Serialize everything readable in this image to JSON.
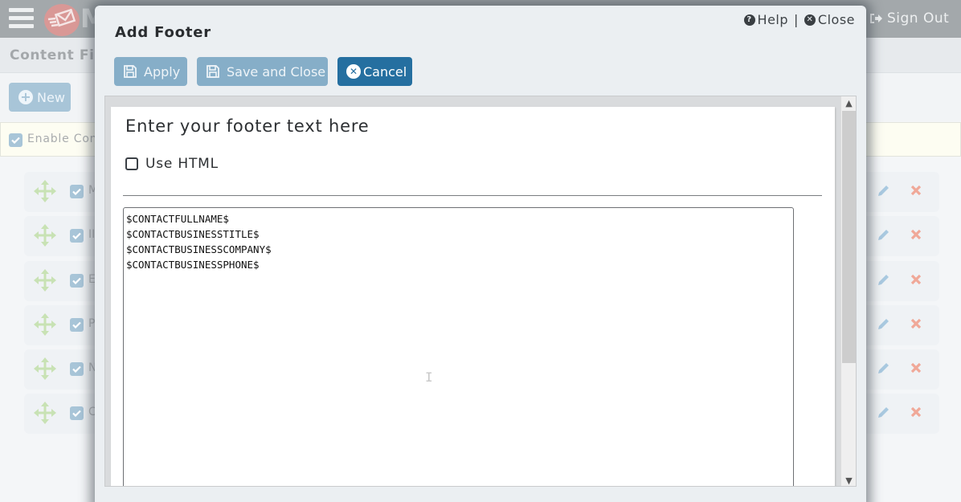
{
  "app": {
    "logo_letter": "M",
    "sign_out_label": "Sign Out",
    "page_title": "Content Fil",
    "new_button_label": "New",
    "enable_label": "Enable Con",
    "enable_checked": true,
    "list_items": [
      {
        "label": "M",
        "checked": true
      },
      {
        "label": "II",
        "checked": true
      },
      {
        "label": "E",
        "checked": true
      },
      {
        "label": "P",
        "checked": true
      },
      {
        "label": "N",
        "checked": true
      },
      {
        "label": "C",
        "checked": true
      }
    ]
  },
  "modal": {
    "title": "Add Footer",
    "help_label": "Help",
    "separator": "|",
    "close_label": "Close",
    "buttons": {
      "apply": "Apply",
      "save_close": "Save and Close",
      "cancel": "Cancel"
    },
    "editor": {
      "heading": "Enter your footer text here",
      "use_html_label": "Use HTML",
      "use_html_checked": false,
      "footer_text": "$CONTACTFULLNAME$\n$CONTACTBUSINESSTITLE$\n$CONTACTBUSINESSCOMPANY$\n$CONTACTBUSINESSPHONE$"
    }
  },
  "colors": {
    "primary": "#256fa0",
    "primary_disabled": "#86aec8",
    "delete": "#f0a898",
    "move": "#c8e2b4"
  }
}
